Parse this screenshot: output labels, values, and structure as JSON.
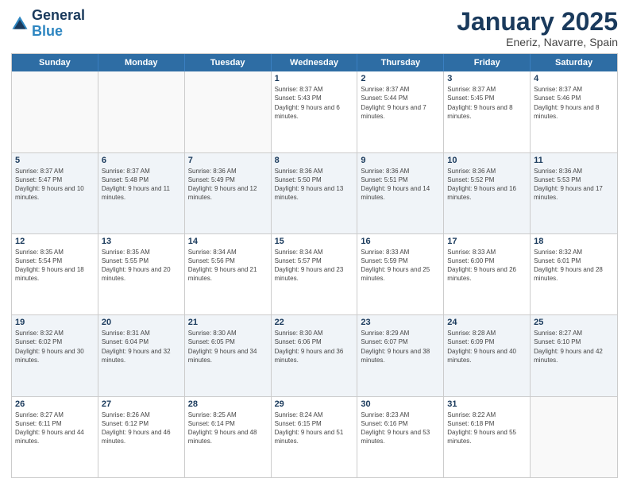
{
  "header": {
    "logo_line1": "General",
    "logo_line2": "Blue",
    "title": "January 2025",
    "subtitle": "Eneriz, Navarre, Spain"
  },
  "day_names": [
    "Sunday",
    "Monday",
    "Tuesday",
    "Wednesday",
    "Thursday",
    "Friday",
    "Saturday"
  ],
  "rows": [
    {
      "alt": false,
      "cells": [
        {
          "date": "",
          "info": ""
        },
        {
          "date": "",
          "info": ""
        },
        {
          "date": "",
          "info": ""
        },
        {
          "date": "1",
          "info": "Sunrise: 8:37 AM\nSunset: 5:43 PM\nDaylight: 9 hours and 6 minutes."
        },
        {
          "date": "2",
          "info": "Sunrise: 8:37 AM\nSunset: 5:44 PM\nDaylight: 9 hours and 7 minutes."
        },
        {
          "date": "3",
          "info": "Sunrise: 8:37 AM\nSunset: 5:45 PM\nDaylight: 9 hours and 8 minutes."
        },
        {
          "date": "4",
          "info": "Sunrise: 8:37 AM\nSunset: 5:46 PM\nDaylight: 9 hours and 8 minutes."
        }
      ]
    },
    {
      "alt": true,
      "cells": [
        {
          "date": "5",
          "info": "Sunrise: 8:37 AM\nSunset: 5:47 PM\nDaylight: 9 hours and 10 minutes."
        },
        {
          "date": "6",
          "info": "Sunrise: 8:37 AM\nSunset: 5:48 PM\nDaylight: 9 hours and 11 minutes."
        },
        {
          "date": "7",
          "info": "Sunrise: 8:36 AM\nSunset: 5:49 PM\nDaylight: 9 hours and 12 minutes."
        },
        {
          "date": "8",
          "info": "Sunrise: 8:36 AM\nSunset: 5:50 PM\nDaylight: 9 hours and 13 minutes."
        },
        {
          "date": "9",
          "info": "Sunrise: 8:36 AM\nSunset: 5:51 PM\nDaylight: 9 hours and 14 minutes."
        },
        {
          "date": "10",
          "info": "Sunrise: 8:36 AM\nSunset: 5:52 PM\nDaylight: 9 hours and 16 minutes."
        },
        {
          "date": "11",
          "info": "Sunrise: 8:36 AM\nSunset: 5:53 PM\nDaylight: 9 hours and 17 minutes."
        }
      ]
    },
    {
      "alt": false,
      "cells": [
        {
          "date": "12",
          "info": "Sunrise: 8:35 AM\nSunset: 5:54 PM\nDaylight: 9 hours and 18 minutes."
        },
        {
          "date": "13",
          "info": "Sunrise: 8:35 AM\nSunset: 5:55 PM\nDaylight: 9 hours and 20 minutes."
        },
        {
          "date": "14",
          "info": "Sunrise: 8:34 AM\nSunset: 5:56 PM\nDaylight: 9 hours and 21 minutes."
        },
        {
          "date": "15",
          "info": "Sunrise: 8:34 AM\nSunset: 5:57 PM\nDaylight: 9 hours and 23 minutes."
        },
        {
          "date": "16",
          "info": "Sunrise: 8:33 AM\nSunset: 5:59 PM\nDaylight: 9 hours and 25 minutes."
        },
        {
          "date": "17",
          "info": "Sunrise: 8:33 AM\nSunset: 6:00 PM\nDaylight: 9 hours and 26 minutes."
        },
        {
          "date": "18",
          "info": "Sunrise: 8:32 AM\nSunset: 6:01 PM\nDaylight: 9 hours and 28 minutes."
        }
      ]
    },
    {
      "alt": true,
      "cells": [
        {
          "date": "19",
          "info": "Sunrise: 8:32 AM\nSunset: 6:02 PM\nDaylight: 9 hours and 30 minutes."
        },
        {
          "date": "20",
          "info": "Sunrise: 8:31 AM\nSunset: 6:04 PM\nDaylight: 9 hours and 32 minutes."
        },
        {
          "date": "21",
          "info": "Sunrise: 8:30 AM\nSunset: 6:05 PM\nDaylight: 9 hours and 34 minutes."
        },
        {
          "date": "22",
          "info": "Sunrise: 8:30 AM\nSunset: 6:06 PM\nDaylight: 9 hours and 36 minutes."
        },
        {
          "date": "23",
          "info": "Sunrise: 8:29 AM\nSunset: 6:07 PM\nDaylight: 9 hours and 38 minutes."
        },
        {
          "date": "24",
          "info": "Sunrise: 8:28 AM\nSunset: 6:09 PM\nDaylight: 9 hours and 40 minutes."
        },
        {
          "date": "25",
          "info": "Sunrise: 8:27 AM\nSunset: 6:10 PM\nDaylight: 9 hours and 42 minutes."
        }
      ]
    },
    {
      "alt": false,
      "cells": [
        {
          "date": "26",
          "info": "Sunrise: 8:27 AM\nSunset: 6:11 PM\nDaylight: 9 hours and 44 minutes."
        },
        {
          "date": "27",
          "info": "Sunrise: 8:26 AM\nSunset: 6:12 PM\nDaylight: 9 hours and 46 minutes."
        },
        {
          "date": "28",
          "info": "Sunrise: 8:25 AM\nSunset: 6:14 PM\nDaylight: 9 hours and 48 minutes."
        },
        {
          "date": "29",
          "info": "Sunrise: 8:24 AM\nSunset: 6:15 PM\nDaylight: 9 hours and 51 minutes."
        },
        {
          "date": "30",
          "info": "Sunrise: 8:23 AM\nSunset: 6:16 PM\nDaylight: 9 hours and 53 minutes."
        },
        {
          "date": "31",
          "info": "Sunrise: 8:22 AM\nSunset: 6:18 PM\nDaylight: 9 hours and 55 minutes."
        },
        {
          "date": "",
          "info": ""
        }
      ]
    }
  ]
}
